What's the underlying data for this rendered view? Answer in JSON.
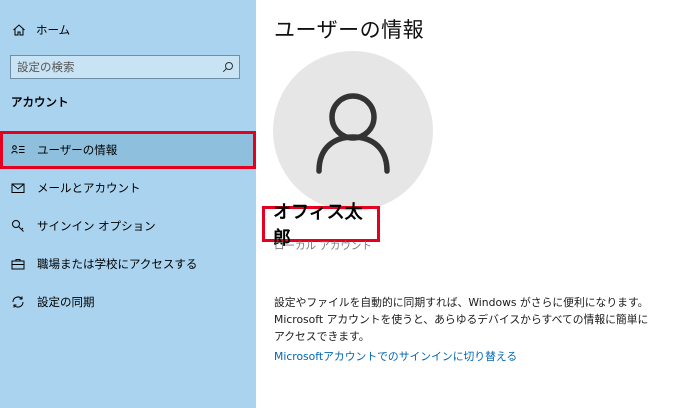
{
  "sidebar": {
    "home_label": "ホーム",
    "search_placeholder": "設定の検索",
    "section_header": "アカウント",
    "items": [
      {
        "label": "ユーザーの情報",
        "icon": "user-info-icon",
        "selected": true
      },
      {
        "label": "メールとアカウント",
        "icon": "mail-icon",
        "selected": false
      },
      {
        "label": "サインイン オプション",
        "icon": "key-icon",
        "selected": false
      },
      {
        "label": "職場または学校にアクセスする",
        "icon": "briefcase-icon",
        "selected": false
      },
      {
        "label": "設定の同期",
        "icon": "sync-icon",
        "selected": false
      }
    ]
  },
  "main": {
    "title": "ユーザーの情報",
    "user_name": "オフィス太郎",
    "account_type": "ローカル アカウント",
    "description": "設定やファイルを自動的に同期すれば、Windows がさらに便利になります。Microsoft アカウントを使うと、あらゆるデバイスからすべての情報に簡単にアクセスできます。",
    "switch_link": "Microsoftアカウントでのサインインに切り替える"
  },
  "colors": {
    "sidebar_bg": "#a9d3ee",
    "selected_bg": "#8ec0de",
    "highlight_red": "#e6001f",
    "link_blue": "#0066b4"
  }
}
